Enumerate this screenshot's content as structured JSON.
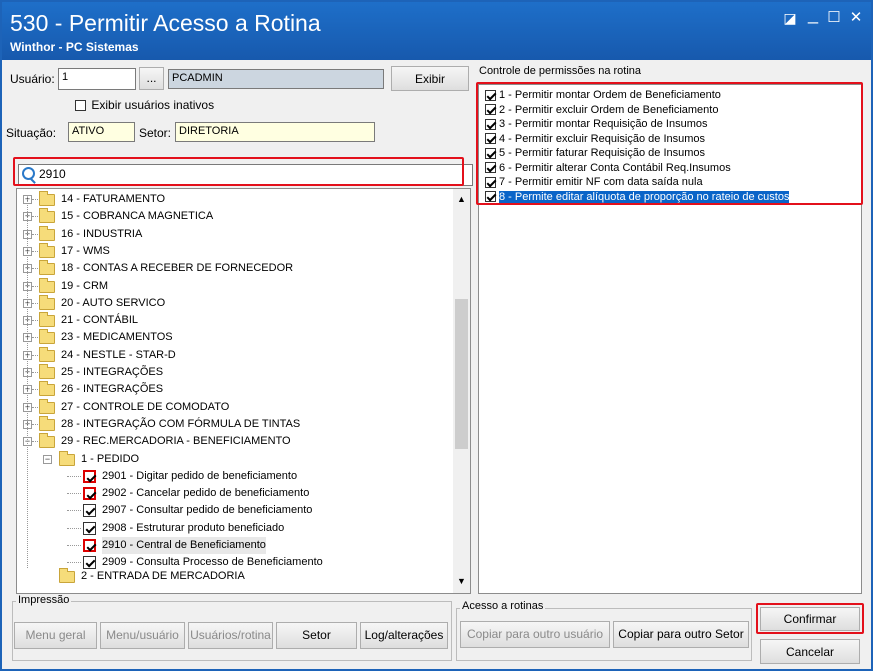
{
  "window": {
    "title": "530 - Permitir Acesso a Rotina",
    "subtitle": "Winthor - PC Sistemas",
    "controls": [
      "◪",
      "_",
      "☐",
      "✕"
    ]
  },
  "user": {
    "label": "Usuário:",
    "id": "1",
    "lookup_label": "...",
    "name": "PCADMIN",
    "show_button": "Exibir",
    "show_inactive_label": "Exibir usuários inativos",
    "situation_label": "Situação:",
    "situation": "ATIVO",
    "sector_label": "Setor:",
    "sector": "DIRETORIA"
  },
  "search": {
    "value": "2910"
  },
  "tree": {
    "folders": [
      "14 - FATURAMENTO",
      "15 - COBRANCA MAGNETICA",
      "16 - INDUSTRIA",
      "17 - WMS",
      "18 - CONTAS A RECEBER DE FORNECEDOR",
      "19 - CRM",
      "20 - AUTO SERVICO",
      "21 - CONTÁBIL",
      "23 - MEDICAMENTOS",
      "24 - NESTLE - STAR-D",
      "25 - INTEGRAÇÕES",
      "26 - INTEGRAÇÕES",
      "27 - CONTROLE DE COMODATO",
      "28 - INTEGRAÇÃO COM FÓRMULA DE TINTAS",
      "29 - REC.MERCADORIA - BENEFICIAMENTO"
    ],
    "subfolder": "1 - PEDIDO",
    "routines": [
      {
        "label": "2901 - Digitar pedido de beneficiamento",
        "checked": true,
        "highlight": true
      },
      {
        "label": "2902 - Cancelar pedido de beneficiamento",
        "checked": true,
        "highlight": true
      },
      {
        "label": "2907 - Consultar pedido de beneficiamento",
        "checked": true,
        "highlight": false
      },
      {
        "label": "2908 - Estruturar produto beneficiado",
        "checked": true,
        "highlight": false
      },
      {
        "label": "2910 - Central de Beneficiamento",
        "checked": true,
        "highlight": true
      },
      {
        "label": "2909 - Consulta Processo de Beneficiamento",
        "checked": true,
        "highlight": false
      }
    ],
    "partial_next": "2 - ENTRADA DE MERCADORIA"
  },
  "permissions": {
    "title": "Controle de permissões na rotina",
    "items": [
      "1 - Permitir montar Ordem de Beneficiamento",
      "2 - Permitir excluir Ordem de Beneficiamento",
      "3 - Permitir montar Requisição de Insumos",
      "4 - Permitir excluir Requisição de Insumos",
      "5 - Permitir faturar Requisição de Insumos",
      "6 - Permitir alterar Conta Contábil Req.Insumos",
      "7 - Permitir emitir NF com data saída nula",
      "8 - Permite editar alíquota de proporção no rateio de custos"
    ]
  },
  "print_group": {
    "title": "Impressão",
    "menu_geral": "Menu geral",
    "menu_usuario": "Menu/usuário",
    "usuarios_rotina": "Usuários/rotina",
    "setor": "Setor",
    "log": "Log/alterações"
  },
  "access_group": {
    "title": "Acesso a rotinas",
    "copy_user": "Copiar para outro usuário",
    "copy_sector": "Copiar para outro Setor"
  },
  "actions": {
    "confirm": "Confirmar",
    "cancel": "Cancelar"
  },
  "colors": {
    "titlebar": "#1e6fc9",
    "highlight": "#e3101b",
    "selection": "#0a64c8"
  }
}
